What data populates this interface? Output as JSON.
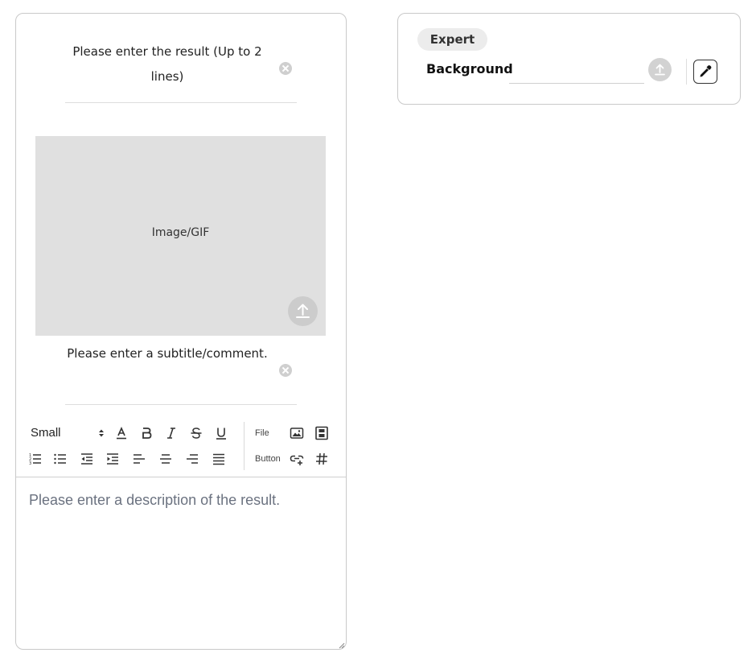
{
  "editor": {
    "title_placeholder": "Please enter the result (Up to 2 lines)",
    "media_label": "Image/GIF",
    "subtitle_placeholder": "Please enter a subtitle/comment.",
    "toolbar": {
      "size_value": "Small",
      "file_label": "File",
      "button_label": "Button"
    },
    "description_placeholder": "Please enter a description of the result."
  },
  "expert": {
    "badge": "Expert",
    "background_label": "Background",
    "background_value": ""
  },
  "icons": {
    "clear": "clear-circle-icon",
    "upload": "upload-icon",
    "color_picker": "eyedropper-icon"
  },
  "colors": {
    "placeholder_gray": "#6b7280",
    "media_bg": "#e0e0e0",
    "badge_bg": "#ececec"
  }
}
